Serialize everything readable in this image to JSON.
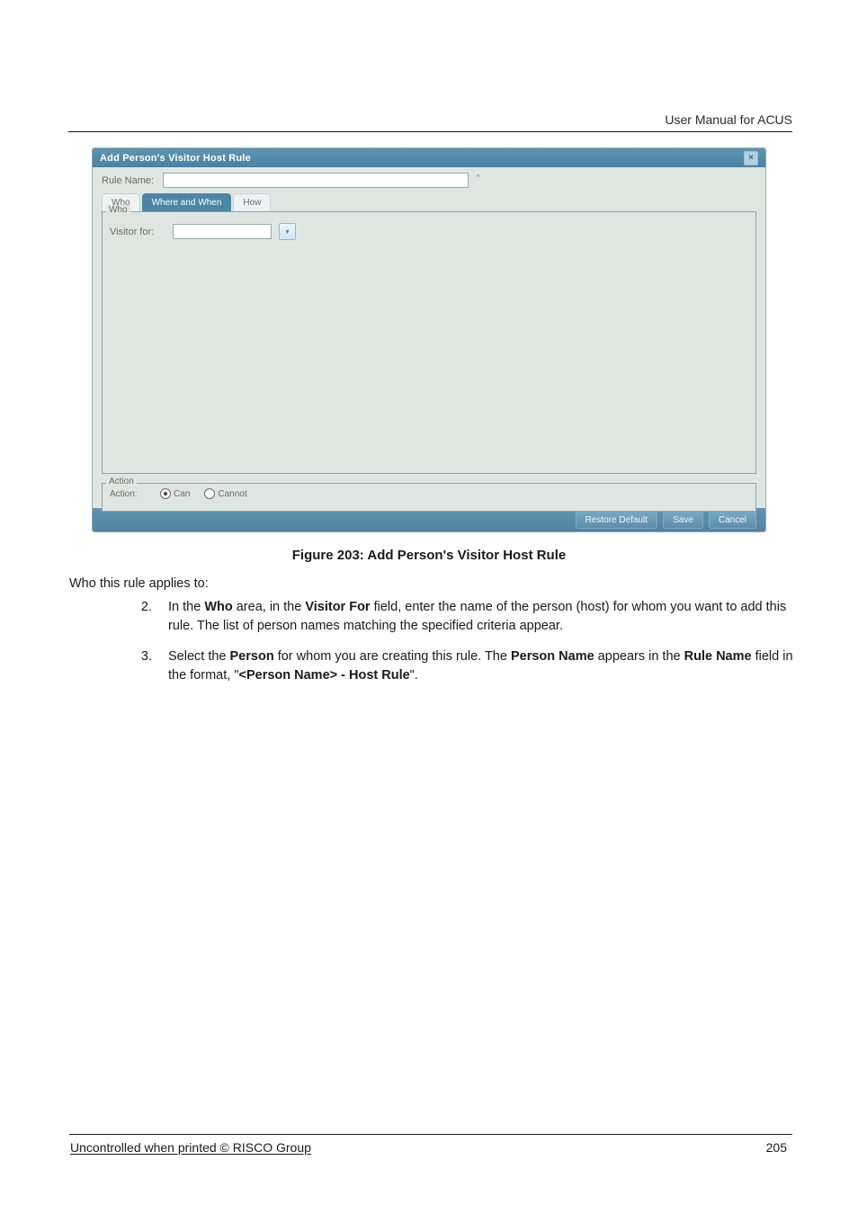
{
  "header": {
    "title": "User Manual for ACUS"
  },
  "screenshot": {
    "window_title": "Add Person's Visitor Host Rule",
    "close_icon": "×",
    "rule_name_label": "Rule Name:",
    "rule_name_value": "",
    "required_mark": "*",
    "tabs": {
      "who": "Who",
      "where_when": "Where and When",
      "how": "How"
    },
    "who_group_label": "Who",
    "visitor_for_label": "Visitor for:",
    "visitor_for_value": "",
    "dropdown_glyph": "▾",
    "action_group_label": "Action",
    "action_label": "Action:",
    "action_can": "Can",
    "action_cannot": "Cannot",
    "buttons": {
      "restore": "Restore Default",
      "save": "Save",
      "cancel": "Cancel"
    }
  },
  "figure_caption": "Figure 203: Add Person's Visitor Host Rule",
  "intro_text": "Who this rule applies to:",
  "steps": {
    "two": {
      "num": "2.",
      "prefix": "In the ",
      "b1": "Who",
      "mid1": " area, in the ",
      "b2": "Visitor For",
      "tail": " field, enter the name of the person (host) for whom you want to add this rule. The list of person names matching the specified criteria appear."
    },
    "three": {
      "num": "3.",
      "prefix": "Select the ",
      "b1": "Person",
      "mid1": " for whom you are creating this rule. The ",
      "b2": "Person Name",
      "mid2": " appears in the ",
      "b3": "Rule Name",
      "mid3": " field in the format, \"",
      "b4": "<Person Name> - Host Rule",
      "tail": "\"."
    }
  },
  "footer": {
    "left": "Uncontrolled when printed © RISCO Group",
    "page": "205"
  }
}
